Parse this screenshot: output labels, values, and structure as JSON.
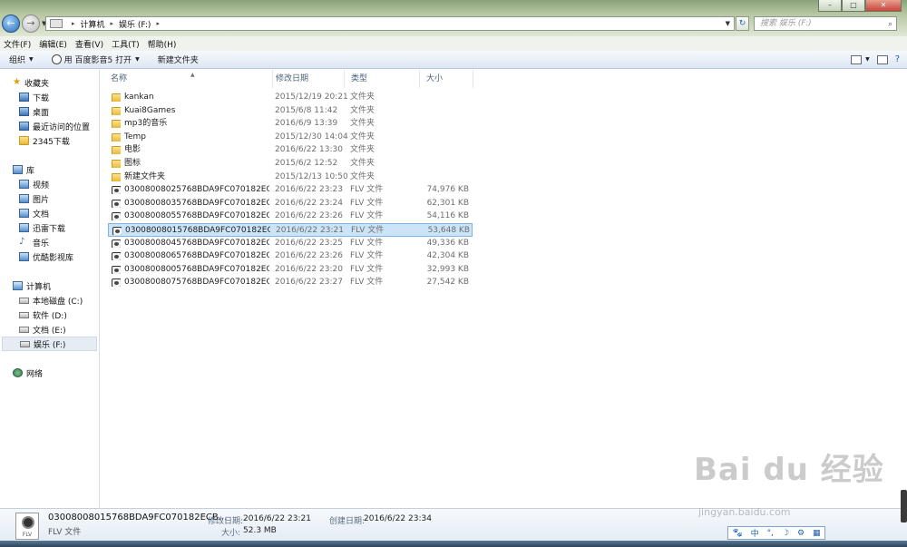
{
  "window": {
    "buttons": {
      "minimize": "–",
      "maximize": "□",
      "close": "✕"
    }
  },
  "address": {
    "crumbs": [
      "计算机",
      "娱乐 (F:)"
    ],
    "search_placeholder": "搜索 娱乐 (F:)"
  },
  "menu": [
    "文件(F)",
    "编辑(E)",
    "查看(V)",
    "工具(T)",
    "帮助(H)"
  ],
  "toolbar": {
    "organize": "组织",
    "open_with": "用 百度影音5 打开",
    "new_folder": "新建文件夹"
  },
  "sidebar": {
    "favorites": {
      "label": "收藏夹",
      "items": [
        "下载",
        "桌面",
        "最近访问的位置",
        "2345下载"
      ]
    },
    "libraries": {
      "label": "库",
      "items": [
        "视频",
        "图片",
        "文档",
        "迅雷下载",
        "音乐",
        "优酷影视库"
      ]
    },
    "computer": {
      "label": "计算机",
      "items": [
        "本地磁盘 (C:)",
        "软件 (D:)",
        "文档 (E:)",
        "娱乐 (F:)"
      ]
    },
    "network": {
      "label": "网络"
    }
  },
  "columns": {
    "name": "名称",
    "date": "修改日期",
    "type": "类型",
    "size": "大小"
  },
  "files": [
    {
      "name": "kankan",
      "date": "2015/12/19 20:21",
      "type": "文件夹",
      "size": "",
      "kind": "folder"
    },
    {
      "name": "Kuai8Games",
      "date": "2015/6/8 11:42",
      "type": "文件夹",
      "size": "",
      "kind": "folder"
    },
    {
      "name": "mp3的音乐",
      "date": "2016/6/9 13:39",
      "type": "文件夹",
      "size": "",
      "kind": "folder"
    },
    {
      "name": "Temp",
      "date": "2015/12/30 14:04",
      "type": "文件夹",
      "size": "",
      "kind": "folder"
    },
    {
      "name": "电影",
      "date": "2016/6/22 13:30",
      "type": "文件夹",
      "size": "",
      "kind": "folder"
    },
    {
      "name": "图标",
      "date": "2015/6/2 12:52",
      "type": "文件夹",
      "size": "",
      "kind": "folder"
    },
    {
      "name": "新建文件夹",
      "date": "2015/12/13 10:50",
      "type": "文件夹",
      "size": "",
      "kind": "folder"
    },
    {
      "name": "03008008025768BDA9FC070182ECB0...",
      "date": "2016/6/22 23:23",
      "type": "FLV 文件",
      "size": "74,976 KB",
      "kind": "video"
    },
    {
      "name": "03008008035768BDA9FC070182ECB0...",
      "date": "2016/6/22 23:24",
      "type": "FLV 文件",
      "size": "62,301 KB",
      "kind": "video"
    },
    {
      "name": "03008008055768BDA9FC070182ECB0...",
      "date": "2016/6/22 23:26",
      "type": "FLV 文件",
      "size": "54,116 KB",
      "kind": "video"
    },
    {
      "name": "03008008015768BDA9FC070182ECB0...",
      "date": "2016/6/22 23:21",
      "type": "FLV 文件",
      "size": "53,648 KB",
      "kind": "video",
      "selected": true
    },
    {
      "name": "03008008045768BDA9FC070182ECB0...",
      "date": "2016/6/22 23:25",
      "type": "FLV 文件",
      "size": "49,336 KB",
      "kind": "video"
    },
    {
      "name": "03008008065768BDA9FC070182ECB0...",
      "date": "2016/6/22 23:26",
      "type": "FLV 文件",
      "size": "42,304 KB",
      "kind": "video"
    },
    {
      "name": "03008008005768BDA9FC070182ECB0...",
      "date": "2016/6/22 23:20",
      "type": "FLV 文件",
      "size": "32,993 KB",
      "kind": "video"
    },
    {
      "name": "03008008075768BDA9FC070182ECB0...",
      "date": "2016/6/22 23:27",
      "type": "FLV 文件",
      "size": "27,542 KB",
      "kind": "video"
    }
  ],
  "details": {
    "thumb_label": "FLV",
    "filename": "03008008015768BDA9FC070182ECB...",
    "filetype": "FLV 文件",
    "modified_label": "修改日期:",
    "modified_value": "2016/6/22 23:21",
    "created_label": "创建日期:",
    "created_value": "2016/6/22 23:34",
    "size_label": "大小:",
    "size_value": "52.3 MB"
  },
  "ime": {
    "items": [
      "🐾",
      "中",
      "°,",
      "☽",
      "⚙",
      "▦"
    ]
  },
  "watermark": {
    "text": "Bai du 经验",
    "url": "jingyan.baidu.com"
  }
}
